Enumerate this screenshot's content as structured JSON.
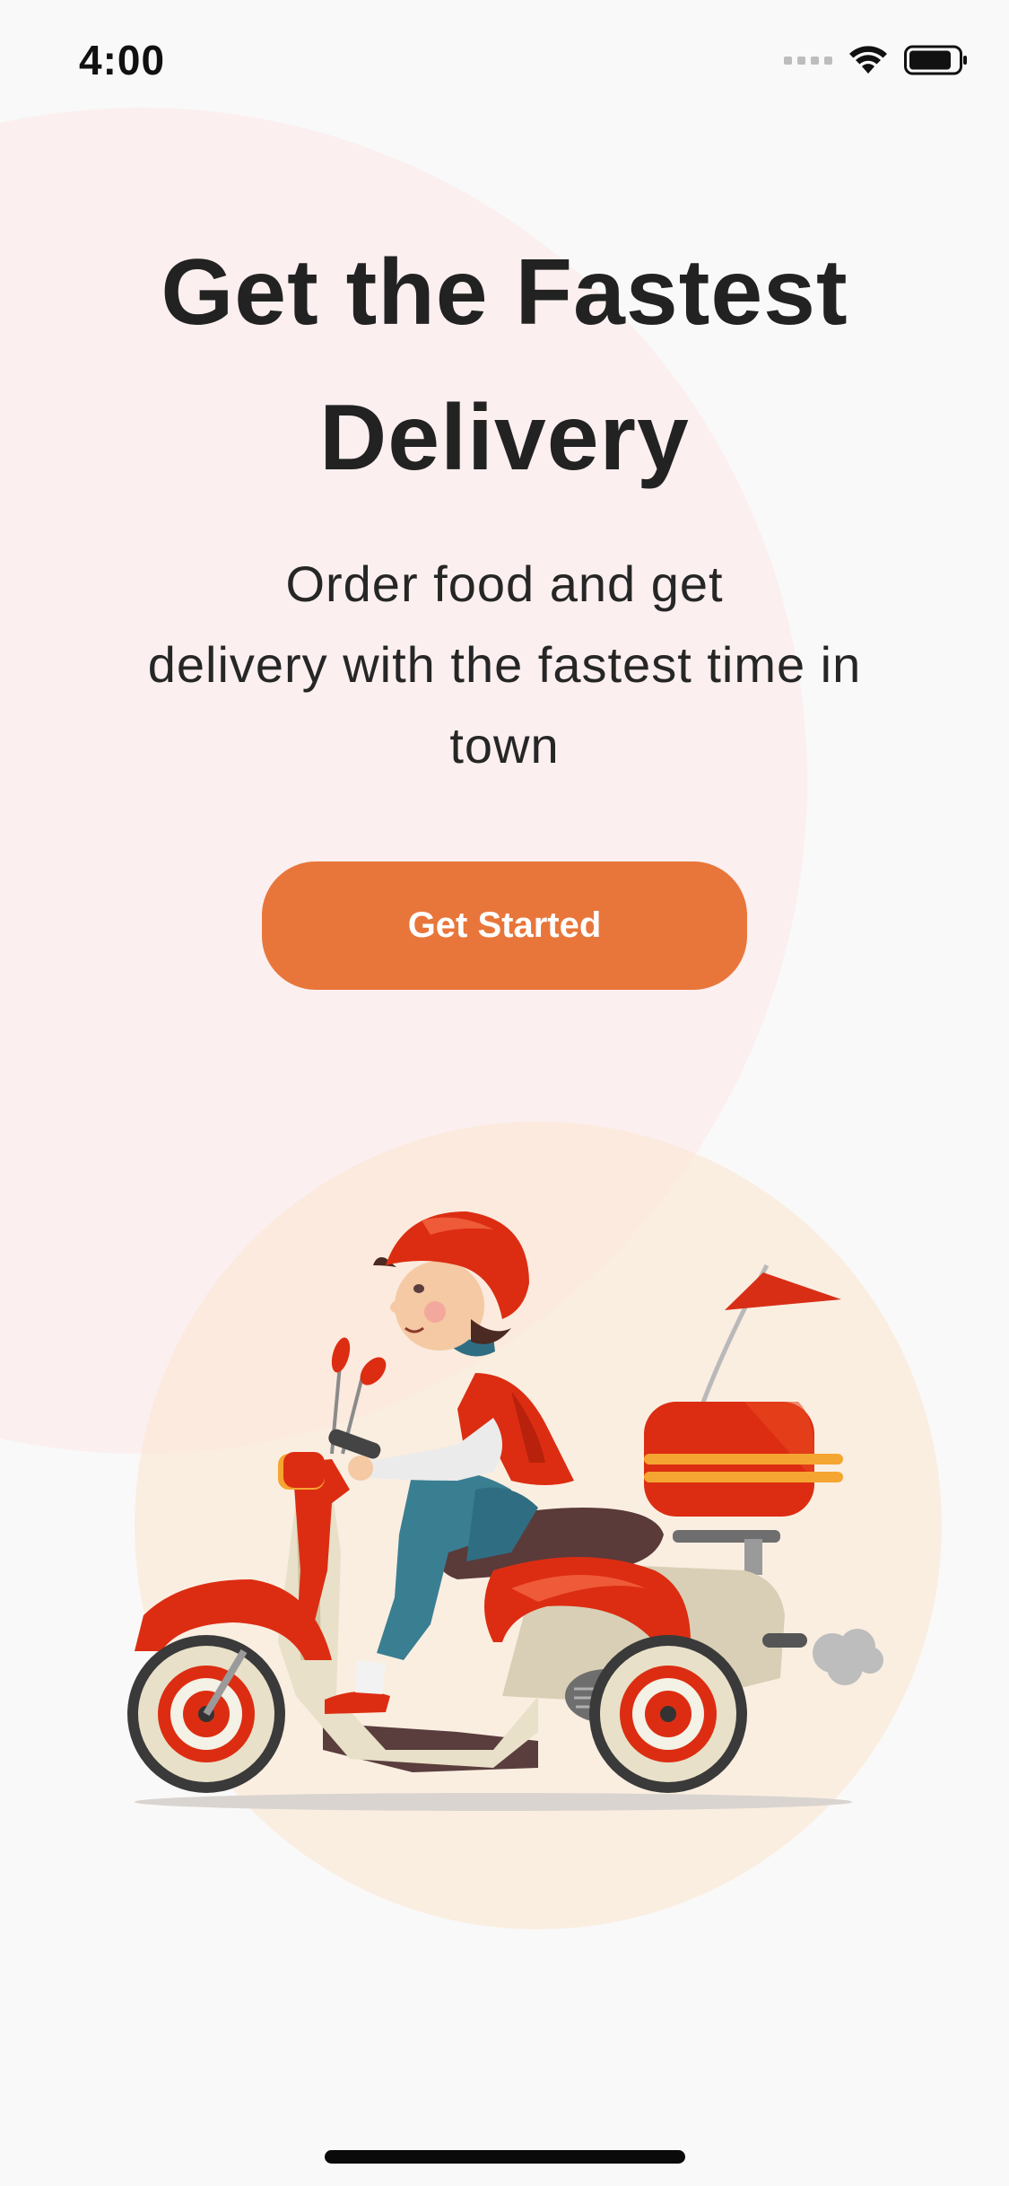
{
  "status_bar": {
    "time": "4:00"
  },
  "onboarding": {
    "title": "Get the Fastest Delivery",
    "subtitle_lines": [
      "Order food and get",
      "delivery with the fastest time in",
      "town"
    ],
    "cta_label": "Get Started"
  },
  "colors": {
    "accent": "#e8763b",
    "background": "#f9f9f9",
    "pink_circle": "#fbefef",
    "peach_circle": "#fbe5cd",
    "title_text": "#222222"
  },
  "icons": {
    "signal": "cellular-signal-icon",
    "wifi": "wifi-icon",
    "battery": "battery-icon",
    "illustration": "scooter-delivery-rider-illustration"
  }
}
